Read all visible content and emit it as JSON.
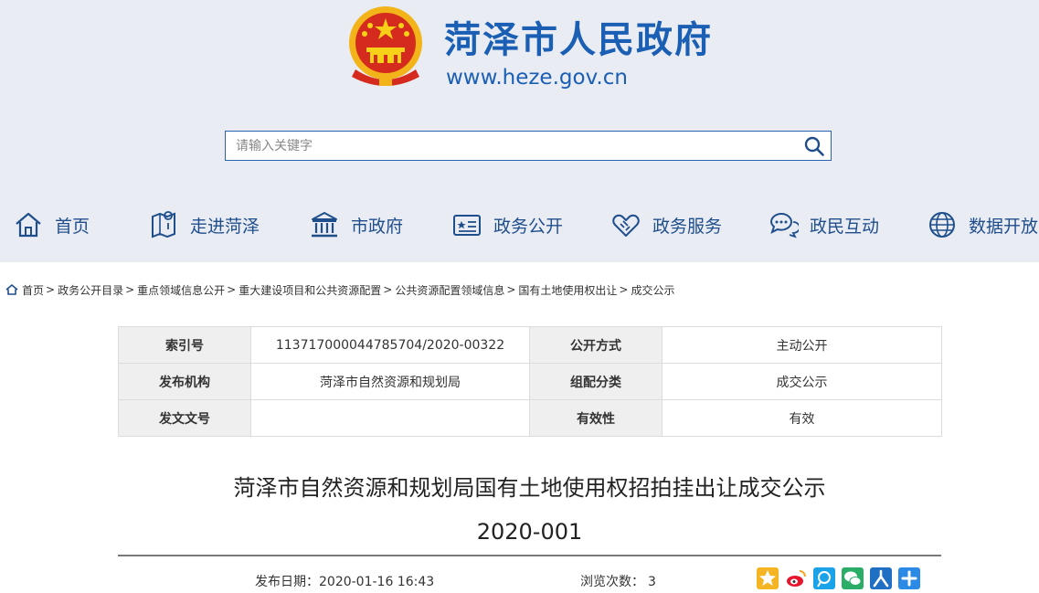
{
  "site": {
    "title": "菏泽市人民政府",
    "url": "www.heze.gov.cn"
  },
  "search": {
    "placeholder": "请输入关键字",
    "value": ""
  },
  "nav": [
    {
      "label": "首页",
      "icon": "home-icon"
    },
    {
      "label": "走进菏泽",
      "icon": "map-icon"
    },
    {
      "label": "市政府",
      "icon": "government-building-icon"
    },
    {
      "label": "政务公开",
      "icon": "public-info-icon"
    },
    {
      "label": "政务服务",
      "icon": "handshake-icon"
    },
    {
      "label": "政民互动",
      "icon": "chat-icon"
    },
    {
      "label": "数据开放",
      "icon": "globe-icon"
    }
  ],
  "breadcrumb": [
    "首页",
    "政务公开目录",
    "重点领域信息公开",
    "重大建设项目和公共资源配置",
    "公共资源配置领域信息",
    "国有土地使用权出让",
    "成交公示"
  ],
  "breadcrumb_separator": ">",
  "info": {
    "rows": [
      {
        "k1": "索引号",
        "v1": "11371700004478570​4/2020-00322",
        "k2": "公开方式",
        "v2": "主动公开"
      },
      {
        "k1": "发布机构",
        "v1": "菏泽市自然资源和规划局",
        "k2": "组配分类",
        "v2": "成交公示"
      },
      {
        "k1": "发文文号",
        "v1": "",
        "k2": "有效性",
        "v2": "有效"
      }
    ]
  },
  "article": {
    "title_line1": "菏泽市自然资源和规划局国有土地使用权招拍挂出让成交公示",
    "title_line2": "2020-001",
    "publish_label": "发布日期：",
    "publish_date": "2020-01-16 16:43",
    "views_label": "浏览次数：",
    "views": "3"
  },
  "share": [
    {
      "icon": "qzone-icon",
      "color": "#f5a623"
    },
    {
      "icon": "weibo-icon",
      "color": "#e6162d"
    },
    {
      "icon": "tencent-weibo-icon",
      "color": "#1aa3e8"
    },
    {
      "icon": "wechat-icon",
      "color": "#2aae67"
    },
    {
      "icon": "renren-icon",
      "color": "#1f6fc5"
    },
    {
      "icon": "more-share-icon",
      "color": "#2b8ae6"
    }
  ],
  "colors": {
    "brand_blue": "#1a5fb4",
    "header_bg": "#e9ecf3",
    "nav_text": "#1f4e8c"
  }
}
